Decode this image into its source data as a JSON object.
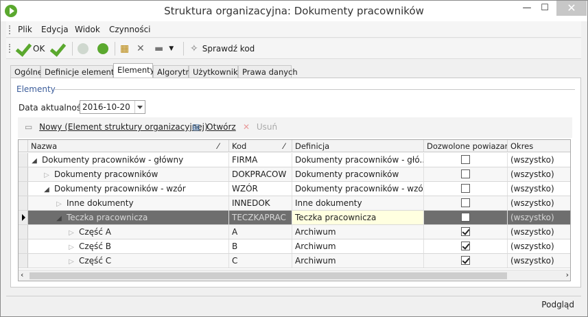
{
  "window": {
    "title": "Struktura organizacyjna: Dokumenty pracowników"
  },
  "menu": [
    "Plik",
    "Edycja",
    "Widok",
    "Czynności"
  ],
  "toolbar": {
    "ok_label": "OK",
    "check_code_label": "Sprawdź kod"
  },
  "tabs": [
    "Ogólne",
    "Definicje elementów",
    "Elementy",
    "Algorytm",
    "Użytkownika",
    "Prawa danych"
  ],
  "active_tab": "Elementy",
  "group": {
    "label": "Elementy"
  },
  "date": {
    "label": "Data aktualności:",
    "value": "2016-10-20"
  },
  "actions": {
    "new_label": "Nowy (Element struktury organizacyjnej)",
    "open_label": "Otwórz",
    "delete_label": "Usuń"
  },
  "grid": {
    "columns": [
      "Nazwa",
      "Kod",
      "Definicja",
      "Dozwolone powiazania",
      "Okres"
    ],
    "rows": [
      {
        "name": "Dokumenty pracowników - główny",
        "code": "FIRMA",
        "definition": "Dokumenty pracowników - głó...",
        "allowed": false,
        "period": "(wszystko)",
        "level": 0,
        "expander": "open"
      },
      {
        "name": "Dokumenty pracowników",
        "code": "DOKPRACOW",
        "definition": "Dokumenty pracowników",
        "allowed": false,
        "period": "(wszystko)",
        "level": 1,
        "expander": "closed"
      },
      {
        "name": "Dokumenty pracowników - wzór",
        "code": "WZÓR",
        "definition": "Dokumenty pracowników - wzór",
        "allowed": false,
        "period": "(wszystko)",
        "level": 1,
        "expander": "open"
      },
      {
        "name": "Inne dokumenty",
        "code": "INNEDOK",
        "definition": "Inne dokumenty",
        "allowed": false,
        "period": "(wszystko)",
        "level": 2,
        "expander": "closed"
      },
      {
        "name": "Teczka pracownicza",
        "code": "TECZKAPRAC",
        "definition": "Teczka pracownicza",
        "allowed": false,
        "period": "(wszystko)",
        "level": 2,
        "expander": "open",
        "selected": true
      },
      {
        "name": "Część A",
        "code": "A",
        "definition": "Archiwum",
        "allowed": true,
        "period": "(wszystko)",
        "level": 3,
        "expander": "closed"
      },
      {
        "name": "Część B",
        "code": "B",
        "definition": "Archiwum",
        "allowed": true,
        "period": "(wszystko)",
        "level": 3,
        "expander": "closed"
      },
      {
        "name": "Część C",
        "code": "C",
        "definition": "Archiwum",
        "allowed": true,
        "period": "(wszystko)",
        "level": 3,
        "expander": "closed"
      }
    ]
  },
  "status": {
    "button_label": "Podgląd"
  }
}
